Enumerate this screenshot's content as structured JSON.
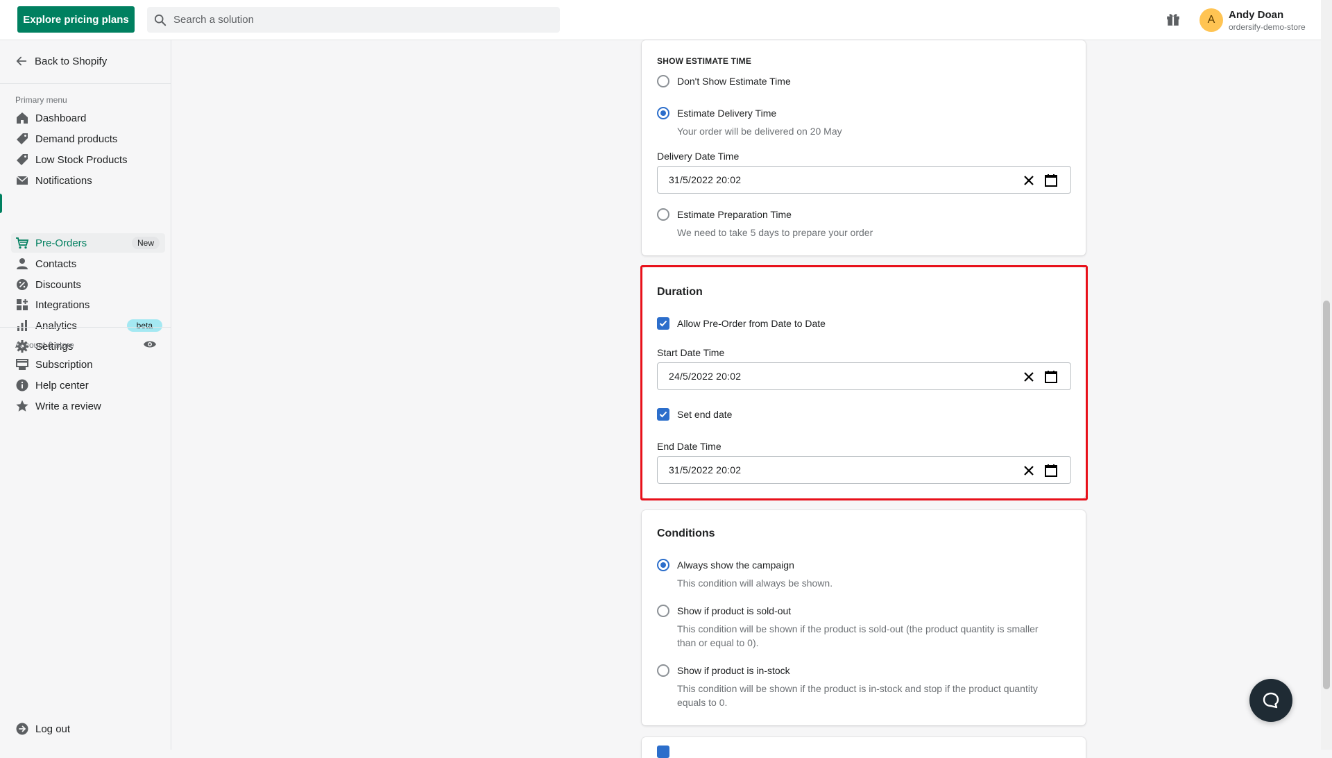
{
  "topbar": {
    "pricing_button": "Explore pricing plans",
    "search_placeholder": "Search a solution",
    "user_initial": "A",
    "user_name": "Andy Doan",
    "user_store": "ordersify-demo-store"
  },
  "sidebar": {
    "back_label": "Back to Shopify",
    "primary_title": "Primary menu",
    "items": [
      {
        "label": "Dashboard",
        "icon": "home-icon"
      },
      {
        "label": "Demand products",
        "icon": "tag-icon"
      },
      {
        "label": "Low Stock Products",
        "icon": "tag-icon"
      },
      {
        "label": "Notifications",
        "icon": "mail-icon"
      },
      {
        "label": "Pre-Orders",
        "icon": "cart-icon",
        "badge": "New"
      },
      {
        "label": "Contacts",
        "icon": "person-icon"
      },
      {
        "label": "Discounts",
        "icon": "discount-icon"
      },
      {
        "label": "Integrations",
        "icon": "apps-icon"
      },
      {
        "label": "Analytics",
        "icon": "bar-chart-icon",
        "badge": "beta"
      },
      {
        "label": "Settings",
        "icon": "gear-icon"
      }
    ],
    "account_title": "Account & store",
    "account_items": [
      {
        "label": "Subscription",
        "icon": "card-icon"
      },
      {
        "label": "Help center",
        "icon": "info-icon"
      },
      {
        "label": "Write a review",
        "icon": "star-icon"
      }
    ],
    "logout_label": "Log out"
  },
  "estimate": {
    "title": "SHOW ESTIMATE TIME",
    "opt_none": "Don't Show Estimate Time",
    "opt_delivery": "Estimate Delivery Time",
    "delivery_help": "Your order will be delivered on 20 May",
    "delivery_label": "Delivery Date Time",
    "delivery_value": "31/5/2022  20:02",
    "opt_prep": "Estimate Preparation Time",
    "prep_help": "We need to take 5 days to prepare your order",
    "selected": "Estimate Delivery Time"
  },
  "duration": {
    "title": "Duration",
    "allow_label": "Allow Pre-Order from Date to Date",
    "start_label": "Start Date Time",
    "start_value": "24/5/2022  20:02",
    "end_check_label": "Set end date",
    "end_label": "End Date Time",
    "end_value": "31/5/2022  20:02"
  },
  "conditions": {
    "title": "Conditions",
    "opt_always": "Always show the campaign",
    "always_help": "This condition will always be shown.",
    "opt_soldout": "Show if product is sold-out",
    "soldout_help_1": "This condition will be shown if the product is sold-out (the product quantity is smaller",
    "soldout_help_2": "than or equal to 0).",
    "opt_instock": "Show if product is in-stock",
    "instock_help_1": "This condition will be shown if the product is in-stock and stop if the product quantity",
    "instock_help_2": "equals to 0.",
    "selected": "Always show the campaign"
  },
  "colors": {
    "brand": "#008060",
    "highlight": "#e8101a",
    "radio_checked": "#2c6ecb"
  }
}
